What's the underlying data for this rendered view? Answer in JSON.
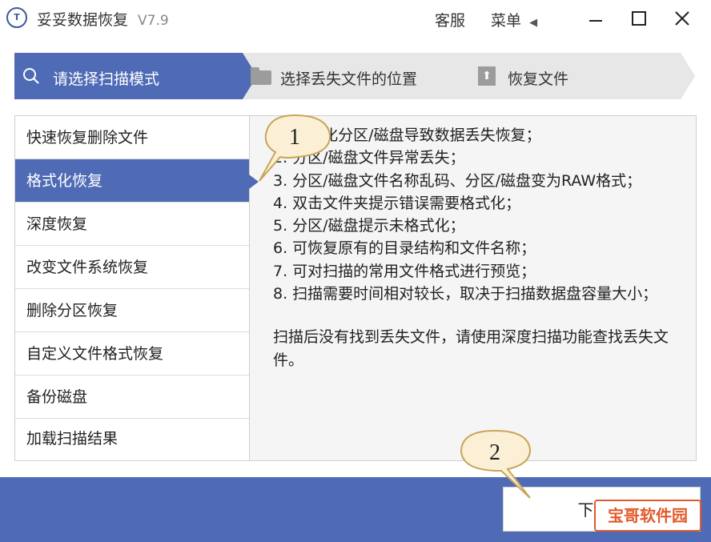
{
  "window": {
    "app_name": "妥妥数据恢复",
    "version": "V7.9",
    "service_label": "客服",
    "menu_label": "菜单",
    "logo_text": "T"
  },
  "steps": [
    {
      "label": "请选择扫描模式"
    },
    {
      "label": "选择丢失文件的位置"
    },
    {
      "label": "恢复文件"
    }
  ],
  "menu_items": [
    {
      "label": "快速恢复删除文件"
    },
    {
      "label": "格式化恢复"
    },
    {
      "label": "深度恢复"
    },
    {
      "label": "改变文件系统恢复"
    },
    {
      "label": "删除分区恢复"
    },
    {
      "label": "自定义文件格式恢复"
    },
    {
      "label": "备份磁盘"
    },
    {
      "label": "加载扫描结果"
    }
  ],
  "description": {
    "lines": [
      "1. 格式化分区/磁盘导致数据丢失恢复；",
      "2. 分区/磁盘文件异常丢失；",
      "3. 分区/磁盘文件名称乱码、分区/磁盘变为RAW格式；",
      "4. 双击文件夹提示错误需要格式化；",
      "5. 分区/磁盘提示未格式化；",
      "6. 可恢复原有的目录结构和文件名称；",
      "7. 可对扫描的常用文件格式进行预览；",
      "8. 扫描需要时间相对较长，取决于扫描数据盘容量大小；"
    ],
    "note": "扫描后没有找到丢失文件，请使用深度扫描功能查找丢失文件。"
  },
  "next_button_label": "下一步",
  "callouts": {
    "first": "1",
    "second": "2"
  },
  "watermark_text": "宝哥软件园",
  "colors": {
    "accent": "#4f6bb6",
    "callout_fill": "#fbf0d6",
    "callout_stroke": "#c9a55a"
  }
}
